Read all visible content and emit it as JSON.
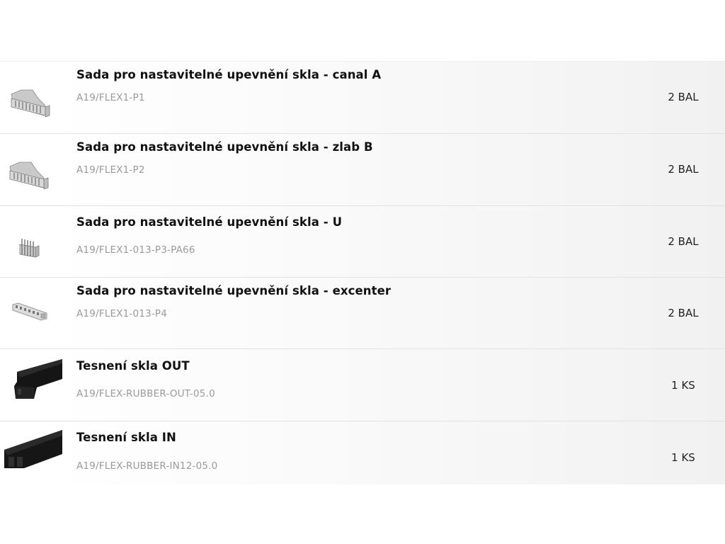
{
  "products": [
    {
      "name": "Sada pro nastavitelné upevnění skla - canal A",
      "code": "A19/FLEX1-P1",
      "quantity": "2 BAL",
      "image_icon": "glass-clamp-set-icon"
    },
    {
      "name": "Sada pro nastavitelné upevnění skla - zlab B",
      "code": "A19/FLEX1-P2",
      "quantity": "2 BAL",
      "image_icon": "glass-clamp-set-icon"
    },
    {
      "name": "Sada pro nastavitelné upevnění skla - U",
      "code": "A19/FLEX1-013-P3-PA66",
      "quantity": "2 BAL",
      "image_icon": "u-clip-icon"
    },
    {
      "name": "Sada pro nastavitelné upevnění skla - excenter",
      "code": "A19/FLEX1-013-P4",
      "quantity": "2 BAL",
      "image_icon": "eccentric-strip-icon"
    },
    {
      "name": "Tesnení skla OUT",
      "code": "A19/FLEX-RUBBER-OUT-05.0",
      "quantity": "1 KS",
      "image_icon": "rubber-seal-out-icon"
    },
    {
      "name": "Tesnení skla IN",
      "code": "A19/FLEX-RUBBER-IN12-05.0",
      "quantity": "1 KS",
      "image_icon": "rubber-seal-in-icon"
    }
  ],
  "colors": {
    "title_text": "#111111",
    "code_text": "#9a9a9a",
    "row_divider": "#e2e2e2"
  }
}
